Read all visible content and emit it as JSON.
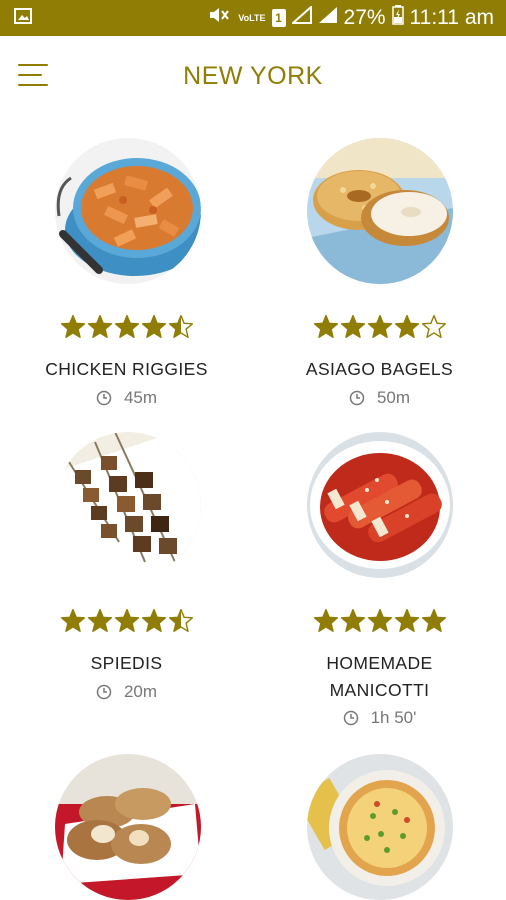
{
  "status_bar": {
    "signal_text": "VoLTE",
    "sim": "1",
    "battery": "27%",
    "time": "11:11 am"
  },
  "app_bar": {
    "title": "NEW YORK"
  },
  "recipes": [
    {
      "name": "CHICKEN RIGGIES",
      "rating": 4.5,
      "time": "45m"
    },
    {
      "name": "ASIAGO BAGELS",
      "rating": 4,
      "time": "50m"
    },
    {
      "name": "SPIEDIS",
      "rating": 4.5,
      "time": "20m"
    },
    {
      "name": "HOMEMADE\nMANICOTTI",
      "name_line1": "HOMEMADE",
      "name_line2": "MANICOTTI",
      "rating": 5,
      "time": "1h 50'"
    },
    {
      "name": "",
      "rating": null,
      "time": ""
    },
    {
      "name": "",
      "rating": null,
      "time": ""
    }
  ],
  "colors": {
    "accent": "#8f7d05",
    "star": "#8f7d05",
    "text": "#222222",
    "muted": "#777777"
  }
}
